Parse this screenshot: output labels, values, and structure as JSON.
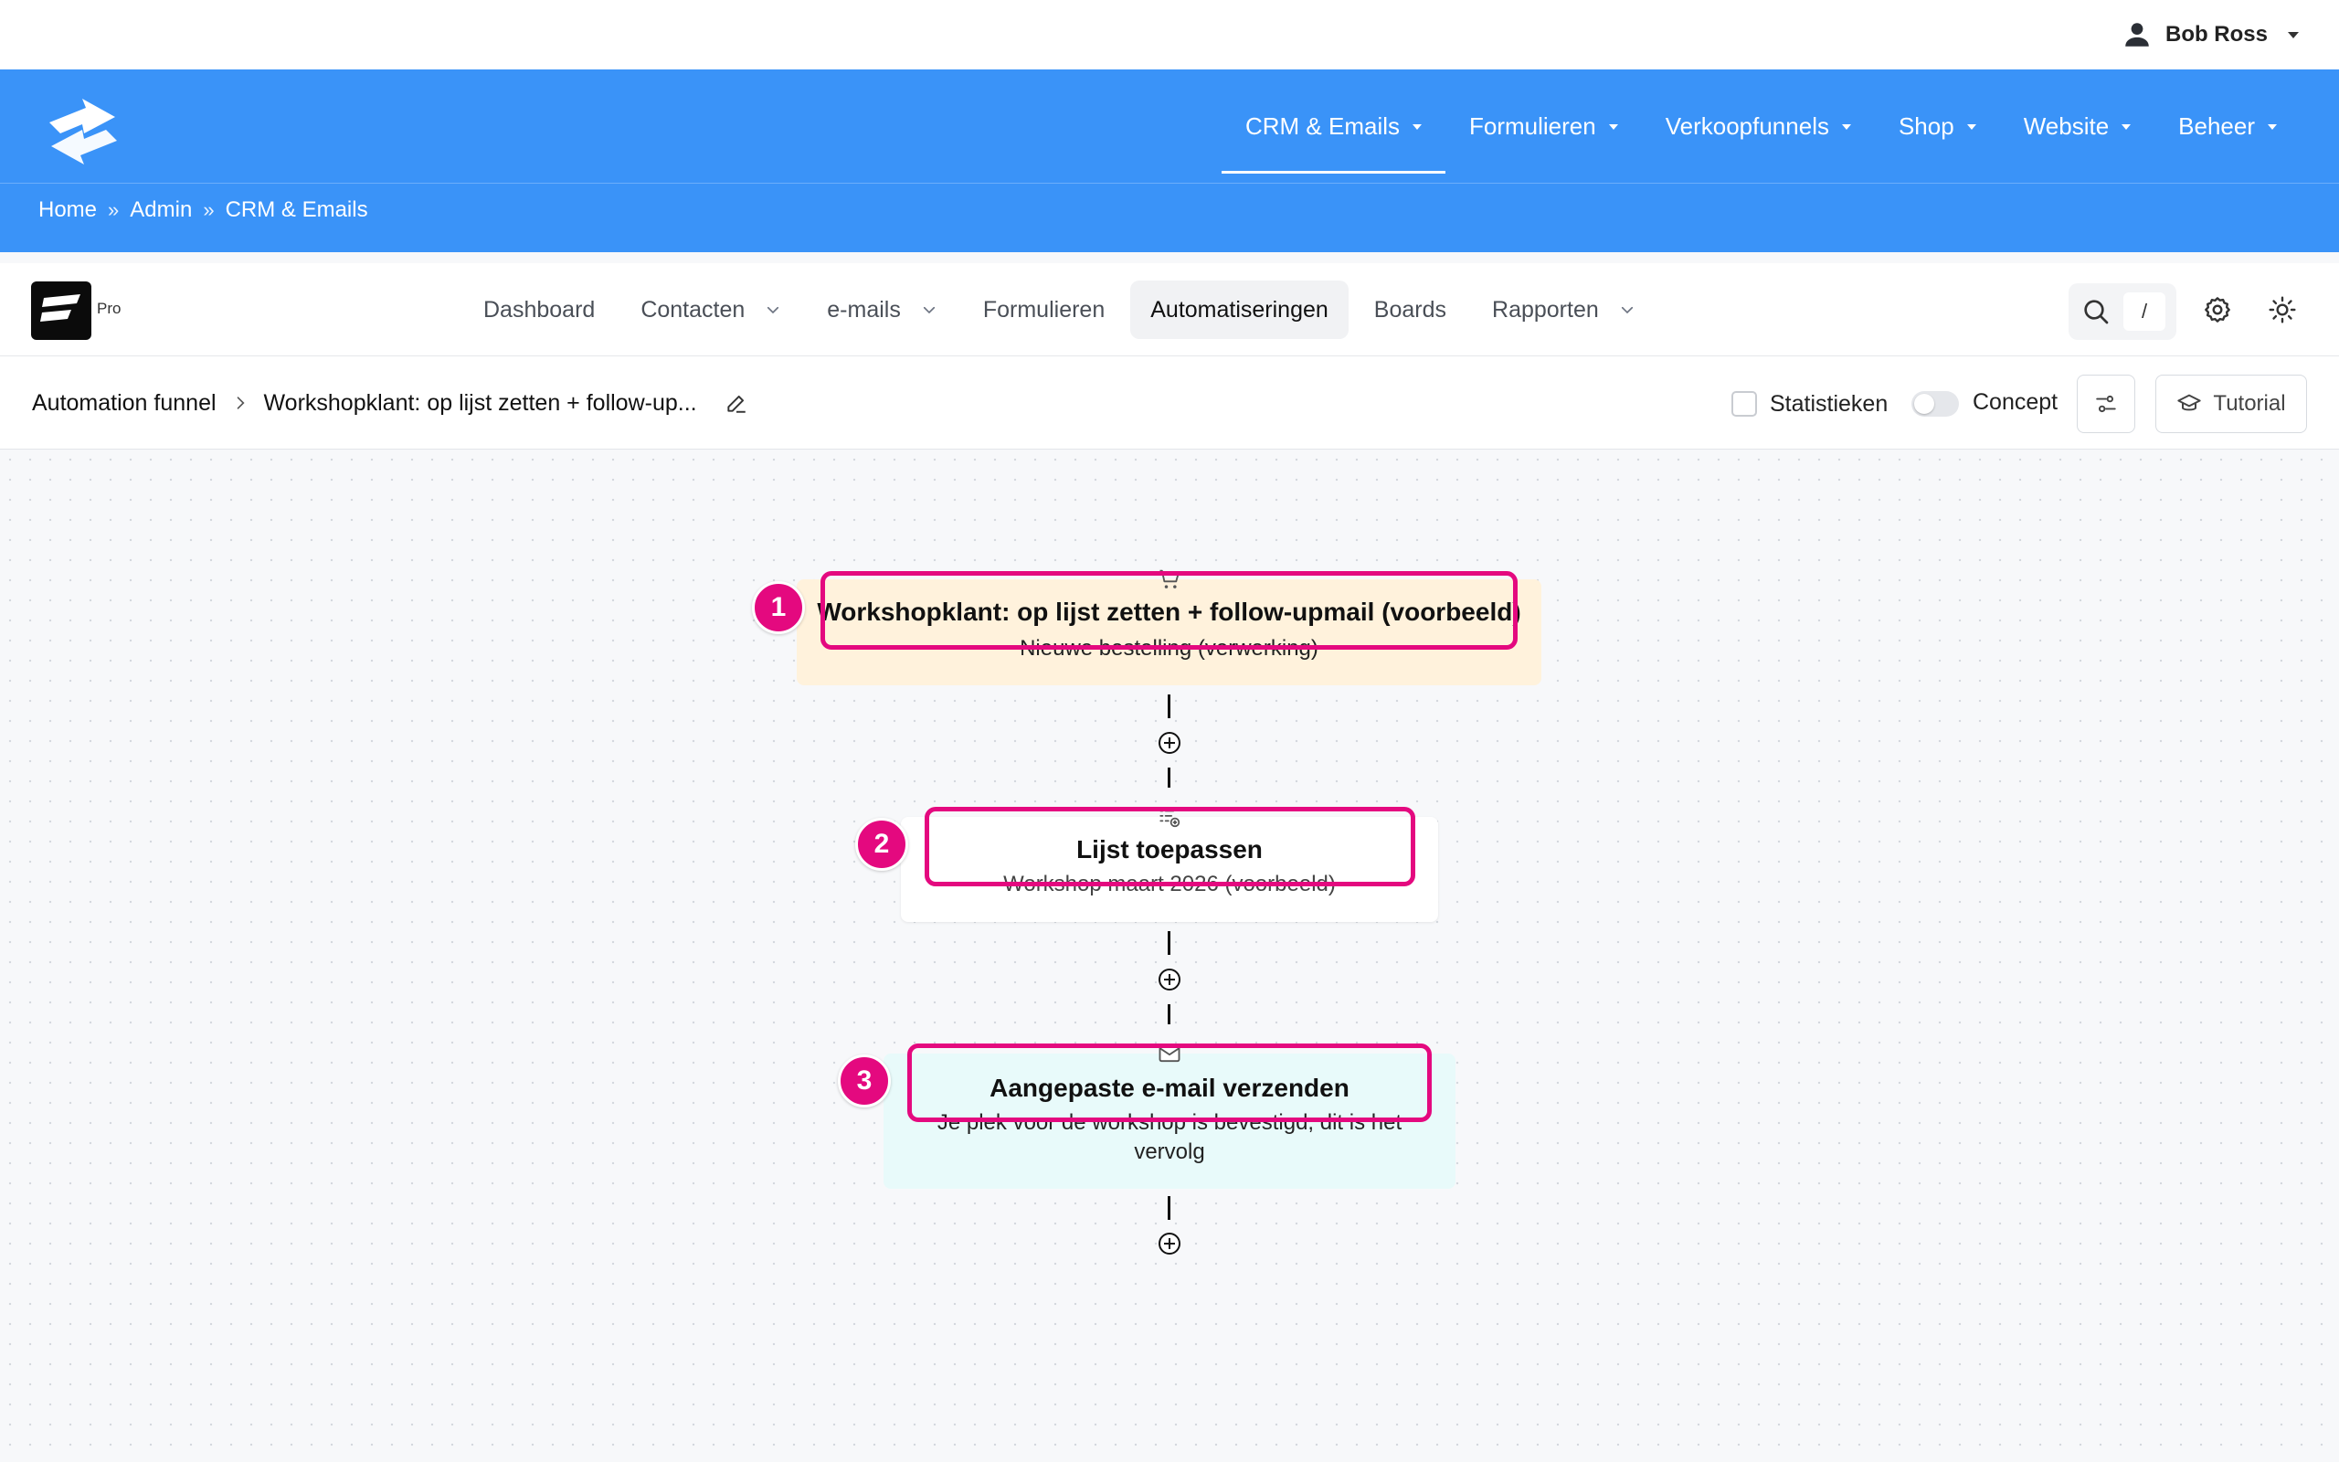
{
  "user": {
    "name": "Bob Ross",
    "icon": "user-icon"
  },
  "main_nav": [
    {
      "label": "CRM & Emails",
      "active": true
    },
    {
      "label": "Formulieren"
    },
    {
      "label": "Verkoopfunnels"
    },
    {
      "label": "Shop"
    },
    {
      "label": "Website"
    },
    {
      "label": "Beheer"
    }
  ],
  "breadcrumb": [
    "Home",
    "Admin",
    "CRM & Emails"
  ],
  "breadcrumb_sep": "»",
  "app": {
    "badge": "Pro"
  },
  "sub_nav": [
    {
      "label": "Dashboard"
    },
    {
      "label": "Contacten",
      "dropdown": true
    },
    {
      "label": "e-mails",
      "dropdown": true
    },
    {
      "label": "Formulieren"
    },
    {
      "label": "Automatiseringen",
      "active": true
    },
    {
      "label": "Boards"
    },
    {
      "label": "Rapporten",
      "dropdown": true
    }
  ],
  "search": {
    "shortcut": "/"
  },
  "funnel": {
    "breadcrumb_root": "Automation funnel",
    "title": "Workshopklant: op lijst zetten + follow-up...",
    "statistics_label": "Statistieken",
    "concept_label": "Concept",
    "tutorial_label": "Tutorial"
  },
  "nodes": [
    {
      "number": "1",
      "title": "Workshopklant: op lijst zetten + follow-upmail (voorbeeld)",
      "subtitle": "Nieuwe bestelling (verwerking)",
      "icon": "cart-icon",
      "color": "#fff2dc"
    },
    {
      "number": "2",
      "title": "Lijst toepassen",
      "subtitle": "Workshop maart 2026 (voorbeeld)",
      "icon": "list-add-icon",
      "color": "#ffffff"
    },
    {
      "number": "3",
      "title": "Aangepaste e-mail verzenden",
      "subtitle_lines": [
        "Je plek voor de workshop is bevestigd, dit is het",
        "vervolg"
      ],
      "icon": "mail-icon",
      "color": "#e8fafa"
    }
  ],
  "colors": {
    "brand_blue": "#3a93f8",
    "highlight": "#e4097f"
  }
}
